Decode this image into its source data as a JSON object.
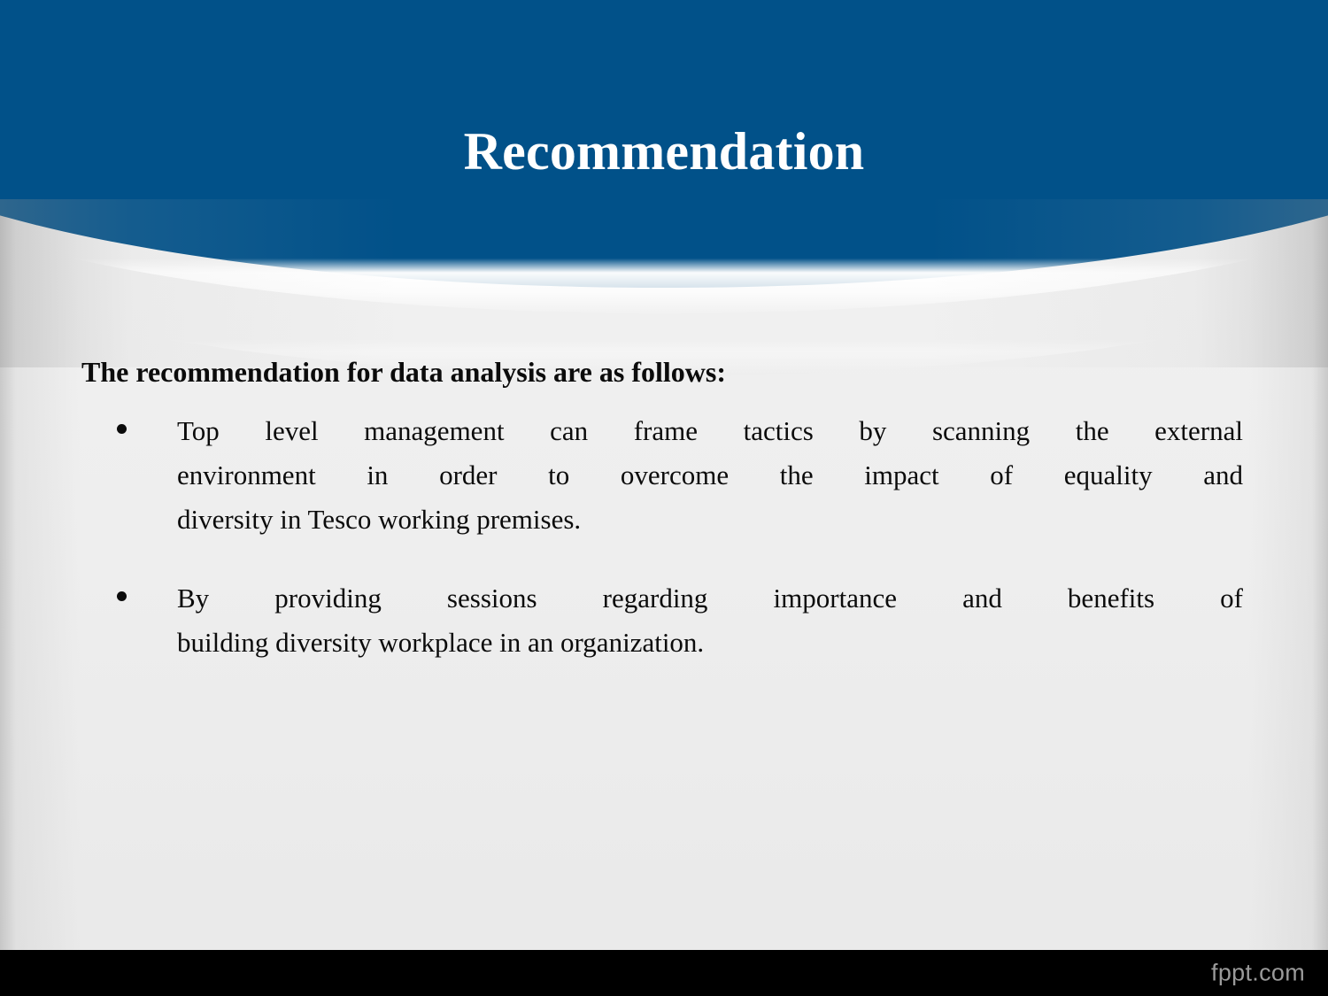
{
  "slide": {
    "title": "Recommendation",
    "lead": "The recommendation for data analysis are as follows:",
    "bullets": [
      {
        "lines": [
          "Top level management can frame tactics by scanning the external",
          "environment in order to overcome the impact of equality and",
          "diversity in Tesco working premises."
        ],
        "text": "Top level management can frame tactics by scanning the external environment in order to overcome the impact of equality and diversity in Tesco working premises."
      },
      {
        "lines": [
          "By providing sessions regarding importance and benefits of",
          "building diversity workplace in an organization."
        ],
        "text": "By providing sessions regarding importance and benefits of building diversity workplace in an organization."
      }
    ]
  },
  "footer": {
    "watermark": "fppt.com"
  },
  "colors": {
    "header_blue": "#015189",
    "body_background": "#efefef",
    "title_text": "#ffffff",
    "body_text": "#0b0b0b",
    "footer_bar": "#000000",
    "watermark_text": "#9a9a9a"
  }
}
